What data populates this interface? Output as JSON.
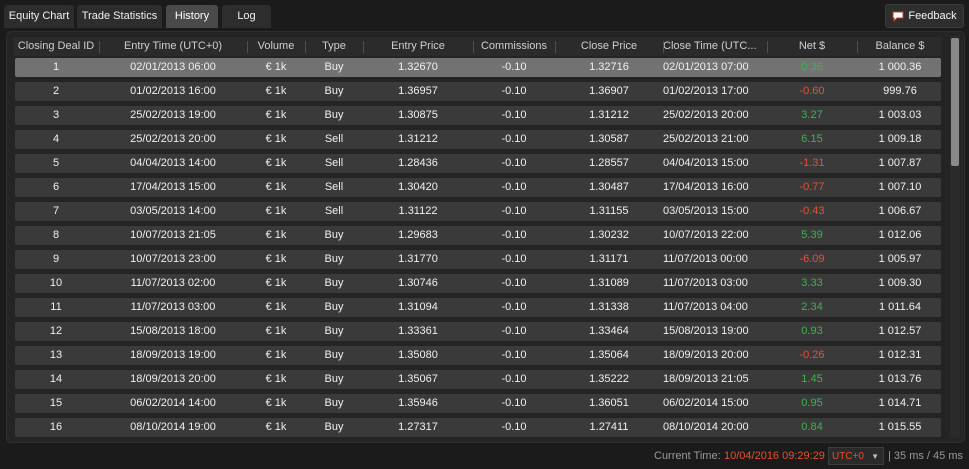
{
  "tabs": [
    {
      "label": "Equity Chart",
      "active": false
    },
    {
      "label": "Trade Statistics",
      "active": false
    },
    {
      "label": "History",
      "active": true
    },
    {
      "label": "Log",
      "active": false
    }
  ],
  "feedback": {
    "label": "Feedback",
    "icon": "feedback-icon"
  },
  "table": {
    "columns": [
      "Closing Deal ID",
      "Entry Time (UTC+0)",
      "Volume",
      "Type",
      "Entry Price",
      "Commissions",
      "Close Price",
      "Close Time (UTC...",
      "Net $",
      "Balance $"
    ],
    "rows": [
      {
        "id": "1",
        "entry_time": "02/01/2013 06:00",
        "volume": "€ 1k",
        "type": "Buy",
        "entry_price": "1.32670",
        "commissions": "-0.10",
        "close_price": "1.32716",
        "close_time": "02/01/2013 07:00",
        "net": "0.36",
        "net_sign": "pos",
        "balance": "1 000.36",
        "selected": true
      },
      {
        "id": "2",
        "entry_time": "01/02/2013 16:00",
        "volume": "€ 1k",
        "type": "Buy",
        "entry_price": "1.36957",
        "commissions": "-0.10",
        "close_price": "1.36907",
        "close_time": "01/02/2013 17:00",
        "net": "-0.60",
        "net_sign": "neg",
        "balance": "999.76"
      },
      {
        "id": "3",
        "entry_time": "25/02/2013 19:00",
        "volume": "€ 1k",
        "type": "Buy",
        "entry_price": "1.30875",
        "commissions": "-0.10",
        "close_price": "1.31212",
        "close_time": "25/02/2013 20:00",
        "net": "3.27",
        "net_sign": "pos",
        "balance": "1 003.03"
      },
      {
        "id": "4",
        "entry_time": "25/02/2013 20:00",
        "volume": "€ 1k",
        "type": "Sell",
        "entry_price": "1.31212",
        "commissions": "-0.10",
        "close_price": "1.30587",
        "close_time": "25/02/2013 21:00",
        "net": "6.15",
        "net_sign": "pos",
        "balance": "1 009.18"
      },
      {
        "id": "5",
        "entry_time": "04/04/2013 14:00",
        "volume": "€ 1k",
        "type": "Sell",
        "entry_price": "1.28436",
        "commissions": "-0.10",
        "close_price": "1.28557",
        "close_time": "04/04/2013 15:00",
        "net": "-1.31",
        "net_sign": "neg",
        "balance": "1 007.87"
      },
      {
        "id": "6",
        "entry_time": "17/04/2013 15:00",
        "volume": "€ 1k",
        "type": "Sell",
        "entry_price": "1.30420",
        "commissions": "-0.10",
        "close_price": "1.30487",
        "close_time": "17/04/2013 16:00",
        "net": "-0.77",
        "net_sign": "neg",
        "balance": "1 007.10"
      },
      {
        "id": "7",
        "entry_time": "03/05/2013 14:00",
        "volume": "€ 1k",
        "type": "Sell",
        "entry_price": "1.31122",
        "commissions": "-0.10",
        "close_price": "1.31155",
        "close_time": "03/05/2013 15:00",
        "net": "-0.43",
        "net_sign": "neg",
        "balance": "1 006.67"
      },
      {
        "id": "8",
        "entry_time": "10/07/2013 21:05",
        "volume": "€ 1k",
        "type": "Buy",
        "entry_price": "1.29683",
        "commissions": "-0.10",
        "close_price": "1.30232",
        "close_time": "10/07/2013 22:00",
        "net": "5.39",
        "net_sign": "pos",
        "balance": "1 012.06"
      },
      {
        "id": "9",
        "entry_time": "10/07/2013 23:00",
        "volume": "€ 1k",
        "type": "Buy",
        "entry_price": "1.31770",
        "commissions": "-0.10",
        "close_price": "1.31171",
        "close_time": "11/07/2013 00:00",
        "net": "-6.09",
        "net_sign": "neg",
        "balance": "1 005.97"
      },
      {
        "id": "10",
        "entry_time": "11/07/2013 02:00",
        "volume": "€ 1k",
        "type": "Buy",
        "entry_price": "1.30746",
        "commissions": "-0.10",
        "close_price": "1.31089",
        "close_time": "11/07/2013 03:00",
        "net": "3.33",
        "net_sign": "pos",
        "balance": "1 009.30"
      },
      {
        "id": "11",
        "entry_time": "11/07/2013 03:00",
        "volume": "€ 1k",
        "type": "Buy",
        "entry_price": "1.31094",
        "commissions": "-0.10",
        "close_price": "1.31338",
        "close_time": "11/07/2013 04:00",
        "net": "2.34",
        "net_sign": "pos",
        "balance": "1 011.64"
      },
      {
        "id": "12",
        "entry_time": "15/08/2013 18:00",
        "volume": "€ 1k",
        "type": "Buy",
        "entry_price": "1.33361",
        "commissions": "-0.10",
        "close_price": "1.33464",
        "close_time": "15/08/2013 19:00",
        "net": "0.93",
        "net_sign": "pos",
        "balance": "1 012.57"
      },
      {
        "id": "13",
        "entry_time": "18/09/2013 19:00",
        "volume": "€ 1k",
        "type": "Buy",
        "entry_price": "1.35080",
        "commissions": "-0.10",
        "close_price": "1.35064",
        "close_time": "18/09/2013 20:00",
        "net": "-0.26",
        "net_sign": "neg",
        "balance": "1 012.31"
      },
      {
        "id": "14",
        "entry_time": "18/09/2013 20:00",
        "volume": "€ 1k",
        "type": "Buy",
        "entry_price": "1.35067",
        "commissions": "-0.10",
        "close_price": "1.35222",
        "close_time": "18/09/2013 21:05",
        "net": "1.45",
        "net_sign": "pos",
        "balance": "1 013.76"
      },
      {
        "id": "15",
        "entry_time": "06/02/2014 14:00",
        "volume": "€ 1k",
        "type": "Buy",
        "entry_price": "1.35946",
        "commissions": "-0.10",
        "close_price": "1.36051",
        "close_time": "06/02/2014 15:00",
        "net": "0.95",
        "net_sign": "pos",
        "balance": "1 014.71"
      },
      {
        "id": "16",
        "entry_time": "08/10/2014 19:00",
        "volume": "€ 1k",
        "type": "Buy",
        "entry_price": "1.27317",
        "commissions": "-0.10",
        "close_price": "1.27411",
        "close_time": "08/10/2014 20:00",
        "net": "0.84",
        "net_sign": "pos",
        "balance": "1 015.55"
      }
    ]
  },
  "statusbar": {
    "current_time_label": "Current Time:",
    "current_time_value": "10/04/2016 09:29:29",
    "timezone": "UTC+0",
    "latency": "| 35 ms / 45 ms"
  },
  "colors": {
    "positive": "#3cb44b",
    "negative": "#e8502f",
    "accent": "#e8502f"
  }
}
